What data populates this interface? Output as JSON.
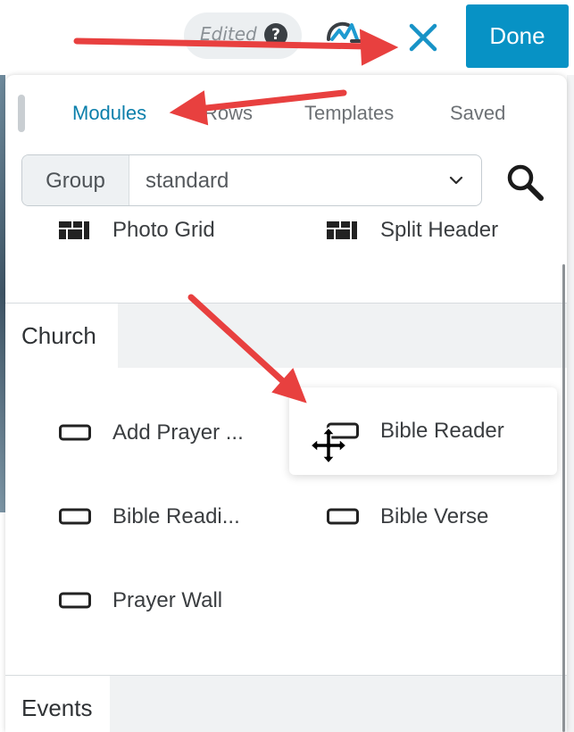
{
  "topbar": {
    "edited_label": "Edited",
    "help_icon_glyph": "?",
    "notification_icon": "notification-logo-icon",
    "close_icon": "close-x-icon",
    "done_label": "Done",
    "accent_color": "#0792c5"
  },
  "panel": {
    "tabs": [
      {
        "label": "Modules",
        "active": true
      },
      {
        "label": "Rows",
        "active": false
      },
      {
        "label": "Templates",
        "active": false
      },
      {
        "label": "Saved",
        "active": false
      }
    ],
    "group": {
      "label": "Group",
      "value": "standard"
    },
    "search_icon": "search-icon"
  },
  "sections": {
    "previous_items": [
      {
        "label": "Photo Grid",
        "icon": "grid-icon"
      },
      {
        "label": "Split Header",
        "icon": "grid-icon"
      }
    ],
    "church": {
      "title": "Church",
      "items": [
        {
          "label": "Add Prayer ...",
          "icon": "module-box-icon"
        },
        {
          "label": "Bible Reader",
          "icon": "module-box-icon",
          "state": "dragging"
        },
        {
          "label": "Bible Readi...",
          "icon": "module-box-icon"
        },
        {
          "label": "Bible Verse",
          "icon": "module-box-icon"
        },
        {
          "label": "Prayer Wall",
          "icon": "module-box-icon"
        }
      ]
    },
    "events": {
      "title": "Events"
    }
  },
  "annotation_color": "#e8403f"
}
